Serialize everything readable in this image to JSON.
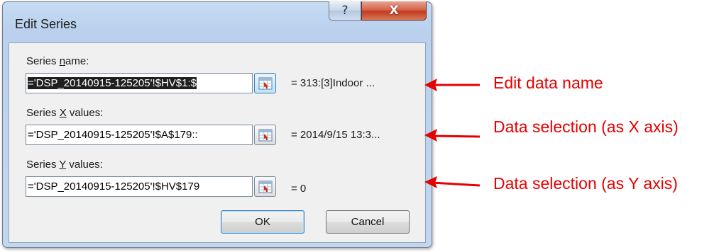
{
  "dialog": {
    "title": "Edit Series",
    "help_glyph": "?",
    "close_glyph": "X",
    "fields": [
      {
        "label_pre": "Series ",
        "label_accel": "n",
        "label_post": "ame:",
        "value": "='DSP_20140915-125205'!$HV$1:$",
        "selected": true,
        "preview": "= 313:[3]Indoor ..."
      },
      {
        "label_pre": "Series ",
        "label_accel": "X",
        "label_post": " values:",
        "value": "='DSP_20140915-125205'!$A$179::",
        "selected": false,
        "preview": "= 2014/9/15 13:3..."
      },
      {
        "label_pre": "Series ",
        "label_accel": "Y",
        "label_post": " values:",
        "value": "='DSP_20140915-125205'!$HV$179",
        "selected": false,
        "preview": "= 0"
      }
    ],
    "ok_label": "OK",
    "cancel_label": "Cancel"
  },
  "annotations": [
    {
      "text": "Edit data name"
    },
    {
      "text": "Data selection (as X axis)"
    },
    {
      "text": "Data selection (as Y axis)"
    }
  ],
  "colors": {
    "annotation": "#e60000",
    "selection_bg": "#1f1f1f"
  }
}
